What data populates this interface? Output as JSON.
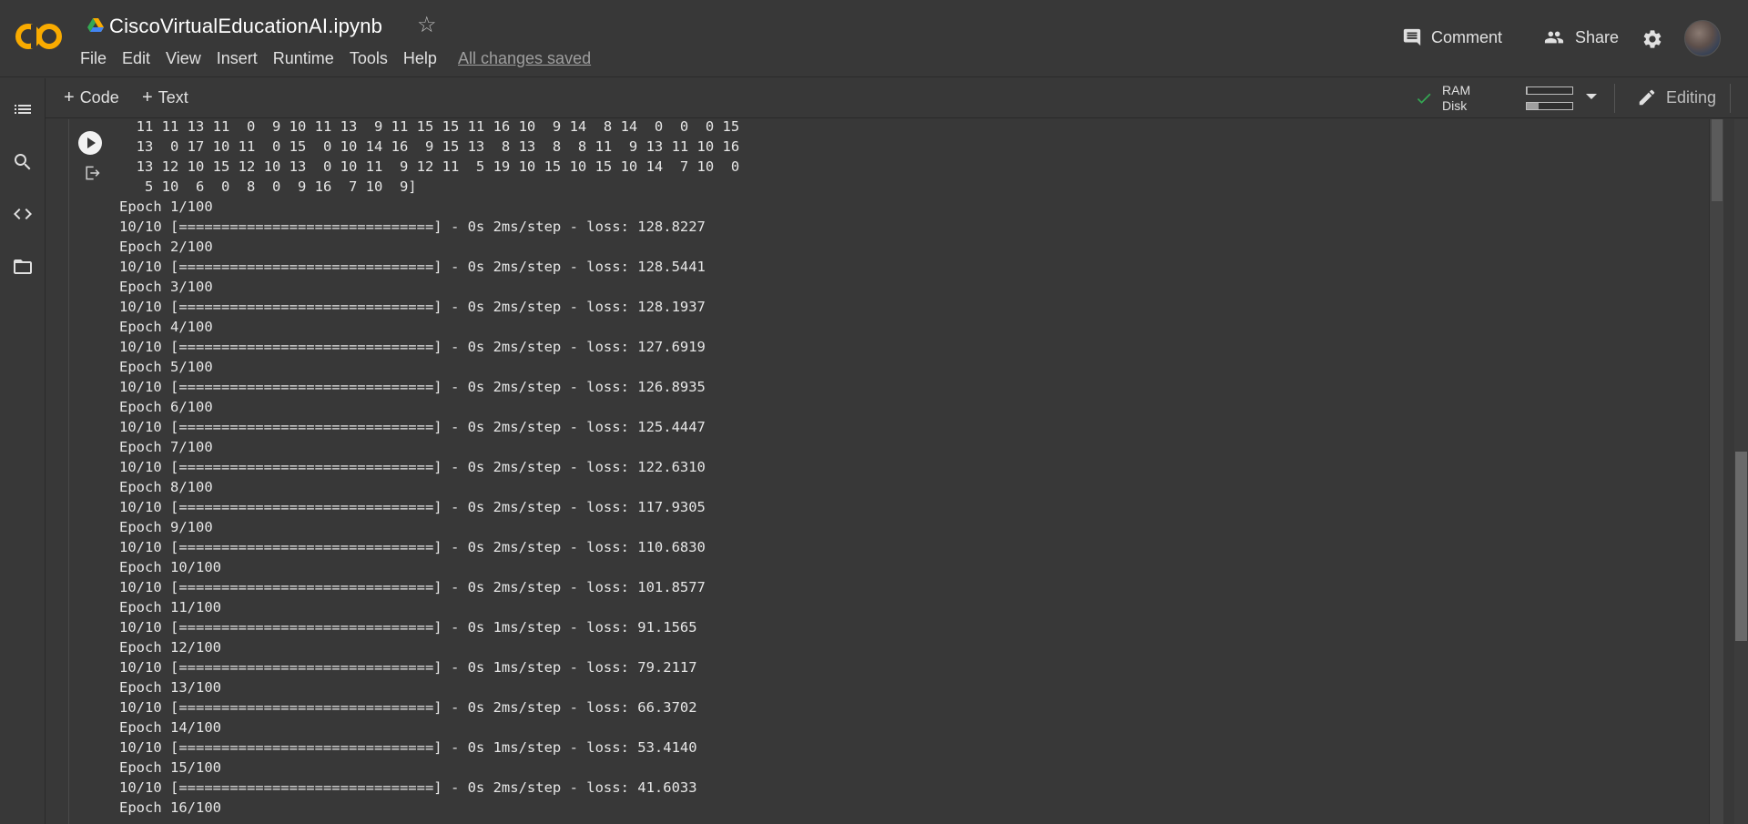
{
  "header": {
    "title": "CiscoVirtualEducationAI.ipynb",
    "menu": [
      "File",
      "Edit",
      "View",
      "Insert",
      "Runtime",
      "Tools",
      "Help"
    ],
    "save_status": "All changes saved",
    "comment_label": "Comment",
    "share_label": "Share",
    "logo_text": "CO"
  },
  "toolbar": {
    "add_code_label": "Code",
    "add_text_label": "Text",
    "ram_label": "RAM",
    "disk_label": "Disk",
    "ram_usage": 0.02,
    "disk_usage": 0.25,
    "editing_label": "Editing"
  },
  "sidebar": {
    "items": [
      "table-of-contents-icon",
      "search-icon",
      "code-snippets-icon",
      "folder-icon"
    ]
  },
  "output": {
    "lines": [
      "  11 11 13 11  0  9 10 11 13  9 11 15 15 11 16 10  9 14  8 14  0  0  0 15",
      "  13  0 17 10 11  0 15  0 10 14 16  9 15 13  8 13  8  8 11  9 13 11 10 16",
      "  13 12 10 15 12 10 13  0 10 11  9 12 11  5 19 10 15 10 15 10 14  7 10  0",
      "   5 10  6  0  8  0  9 16  7 10  9]",
      "Epoch 1/100",
      "10/10 [==============================] - 0s 2ms/step - loss: 128.8227",
      "Epoch 2/100",
      "10/10 [==============================] - 0s 2ms/step - loss: 128.5441",
      "Epoch 3/100",
      "10/10 [==============================] - 0s 2ms/step - loss: 128.1937",
      "Epoch 4/100",
      "10/10 [==============================] - 0s 2ms/step - loss: 127.6919",
      "Epoch 5/100",
      "10/10 [==============================] - 0s 2ms/step - loss: 126.8935",
      "Epoch 6/100",
      "10/10 [==============================] - 0s 2ms/step - loss: 125.4447",
      "Epoch 7/100",
      "10/10 [==============================] - 0s 2ms/step - loss: 122.6310",
      "Epoch 8/100",
      "10/10 [==============================] - 0s 2ms/step - loss: 117.9305",
      "Epoch 9/100",
      "10/10 [==============================] - 0s 2ms/step - loss: 110.6830",
      "Epoch 10/100",
      "10/10 [==============================] - 0s 2ms/step - loss: 101.8577",
      "Epoch 11/100",
      "10/10 [==============================] - 0s 1ms/step - loss: 91.1565",
      "Epoch 12/100",
      "10/10 [==============================] - 0s 1ms/step - loss: 79.2117",
      "Epoch 13/100",
      "10/10 [==============================] - 0s 2ms/step - loss: 66.3702",
      "Epoch 14/100",
      "10/10 [==============================] - 0s 1ms/step - loss: 53.4140",
      "Epoch 15/100",
      "10/10 [==============================] - 0s 2ms/step - loss: 41.6033",
      "Epoch 16/100"
    ]
  },
  "colors": {
    "background": "#383838",
    "logo_orange": "#F9AB00",
    "check_green": "#34A853"
  }
}
